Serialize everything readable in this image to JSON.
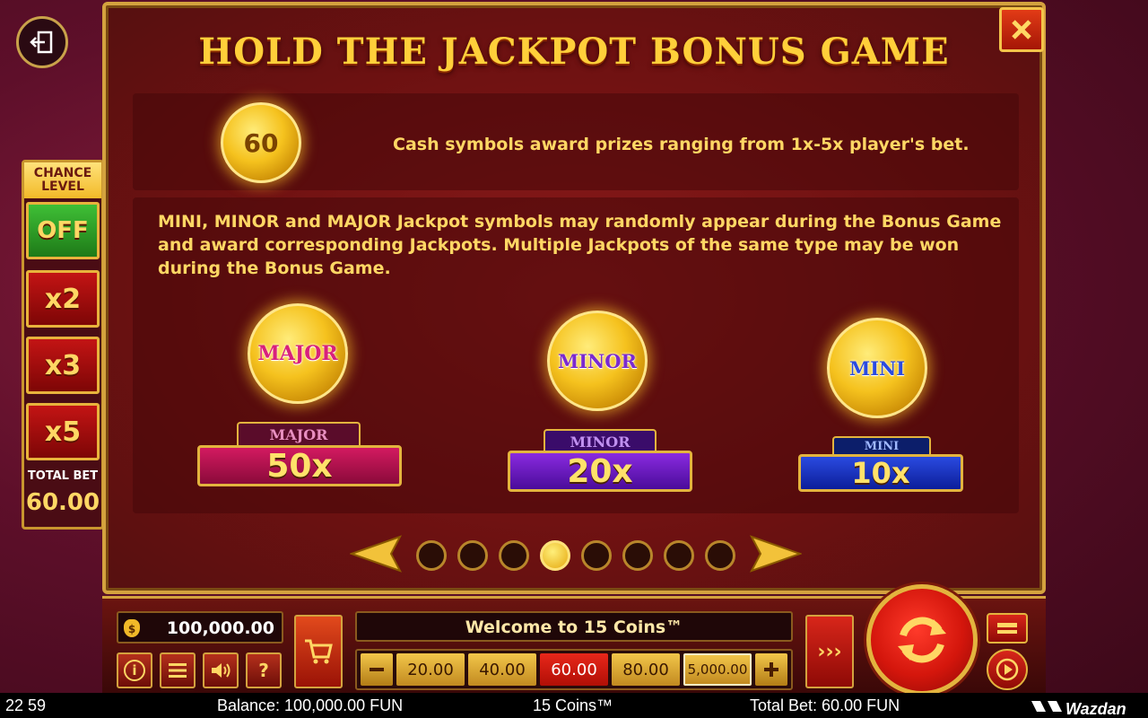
{
  "modal": {
    "title": "HOLD THE JACKPOT BONUS GAME",
    "cash_coin_value": "60",
    "cash_text": "Cash symbols award prizes ranging from 1x-5x player's bet.",
    "jackpot_text": "MINI, MINOR and MAJOR Jackpot symbols may randomly appear during the Bonus Game and award corresponding Jackpots. Multiple Jackpots of the same type may be won during the Bonus Game.",
    "jackpots": [
      {
        "coin_label": "MAJOR",
        "tab_label": "MAJOR",
        "multiplier": "50x",
        "color": "#b3124f",
        "text_color": "#d8207c"
      },
      {
        "coin_label": "MINOR",
        "tab_label": "MINOR",
        "multiplier": "20x",
        "color": "#6a1fb8",
        "text_color": "#7a2ad0"
      },
      {
        "coin_label": "MINI",
        "tab_label": "MINI",
        "multiplier": "10x",
        "color": "#1f3fc8",
        "text_color": "#2a4ae0"
      }
    ],
    "pagination": {
      "total": 8,
      "active_index": 3
    }
  },
  "chance_level": {
    "title_line1": "CHANCE",
    "title_line2": "LEVEL",
    "options": [
      "OFF",
      "x2",
      "x3",
      "x5"
    ],
    "total_bet_label": "TOTAL BET",
    "total_bet_value": "60.00"
  },
  "controls": {
    "balance": "100,000.00",
    "welcome": "Welcome to 15 Coins™",
    "bet_options": [
      "20.00",
      "40.00",
      "60.00",
      "80.00",
      "5,000.00"
    ],
    "selected_bet_index": 2,
    "info_label": "i",
    "help_label": "?",
    "turbo_label": "›››"
  },
  "status_bar": {
    "time": "22 59",
    "balance": "Balance: 100,000.00 FUN",
    "game": "15 Coins™",
    "total_bet": "Total Bet: 60.00 FUN",
    "brand": "Wazdan"
  },
  "colors": {
    "gold": "#ffd764",
    "accent_red": "#d4160c",
    "border_gold": "#d4a23e"
  }
}
